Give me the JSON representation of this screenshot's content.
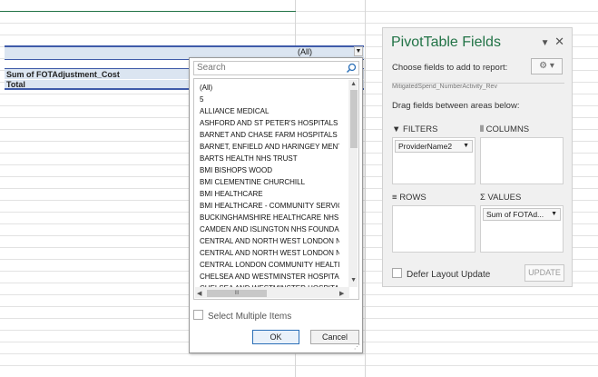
{
  "filter": {
    "selected_value": "(All)"
  },
  "pivot": {
    "header_label": "Sum of FOTAdjustment_Cost",
    "total_label": "Total"
  },
  "dropdown": {
    "search_placeholder": "Search",
    "items": [
      "(All)",
      "5",
      "ALLIANCE MEDICAL",
      "ASHFORD AND ST PETER'S HOSPITALS N",
      "BARNET AND CHASE FARM HOSPITALS N",
      "BARNET, ENFIELD AND HARINGEY MENT",
      "BARTS HEALTH NHS TRUST",
      "BMI BISHOPS WOOD",
      "BMI CLEMENTINE CHURCHILL",
      "BMI HEALTHCARE",
      "BMI HEALTHCARE - COMMUNITY SERVIC",
      "BUCKINGHAMSHIRE HEALTHCARE NHS T",
      "CAMDEN AND ISLINGTON NHS FOUNDA",
      "CENTRAL AND NORTH WEST LONDON N",
      "CENTRAL AND NORTH WEST LONDON N",
      "CENTRAL LONDON COMMUNITY HEALTI",
      "CHELSEA AND WESTMINSTER HOSPITAL",
      "CHELSEA AND WESTMINSTER HOSPITAL"
    ],
    "scroll_grip": "III",
    "multi_label": "Select Multiple Items",
    "ok_label": "OK",
    "cancel_label": "Cancel"
  },
  "panel": {
    "title": "PivotTable Fields",
    "choose_label": "Choose fields to add to report:",
    "fieldlist_stub": "MitigatedSpend_NumberActivity_Rev",
    "drag_label": "Drag fields between areas below:",
    "filters_label": "FILTERS",
    "columns_label": "COLUMNS",
    "rows_label": "ROWS",
    "values_label": "VALUES",
    "filter_chip": "ProviderName2",
    "values_chip": "Sum of FOTAd...",
    "defer_label": "Defer Layout Update",
    "update_label": "UPDATE"
  },
  "colors": {
    "accent": "#217346",
    "pivot_fill": "#dbe5f1",
    "pivot_border": "#3f5ba9"
  }
}
